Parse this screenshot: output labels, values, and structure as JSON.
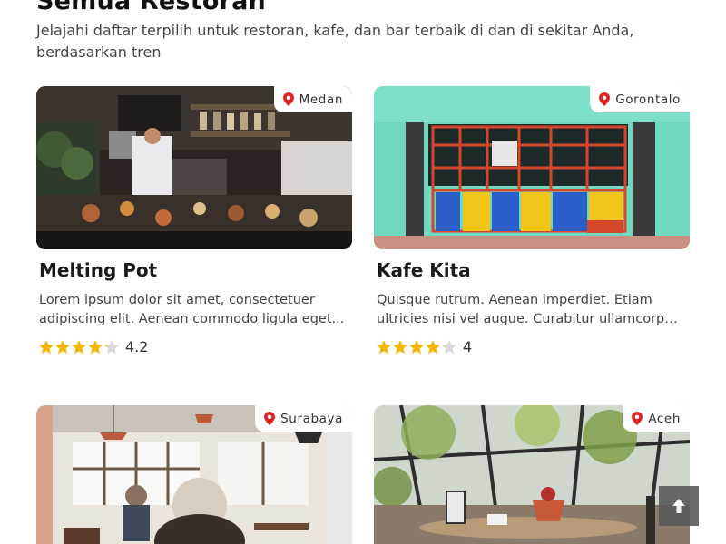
{
  "header": {
    "title": "Semua Restoran",
    "subtitle_line1": "Jelajahi daftar terpilih untuk restoran, kafe, dan bar terbaik di dan di sekitar Anda,",
    "subtitle_line2": "berdasarkan tren"
  },
  "restaurants": [
    {
      "name": "Melting Pot",
      "city": "Medan",
      "desc_line1": "Lorem ipsum dolor sit amet, consectetuer",
      "desc_line2": "adipiscing elit. Aenean commodo ligula eget...",
      "rating": 4.2,
      "rating_text": "4.2"
    },
    {
      "name": "Kafe Kita",
      "city": "Gorontalo",
      "desc_line1": "Quisque rutrum. Aenean imperdiet. Etiam",
      "desc_line2": "ultricies nisi vel augue. Curabitur ullamcorper...",
      "rating": 4,
      "rating_text": "4"
    },
    {
      "city": "Surabaya"
    },
    {
      "city": "Aceh"
    }
  ],
  "colors": {
    "accent_pin": "#e02424",
    "star_filled": "#f5b50a",
    "star_empty": "#d9d9d9",
    "scroll_button": "#5a5a5a"
  },
  "icons": {
    "location": "map-pin-icon",
    "star": "star-icon",
    "scroll_top": "arrow-up-icon"
  }
}
